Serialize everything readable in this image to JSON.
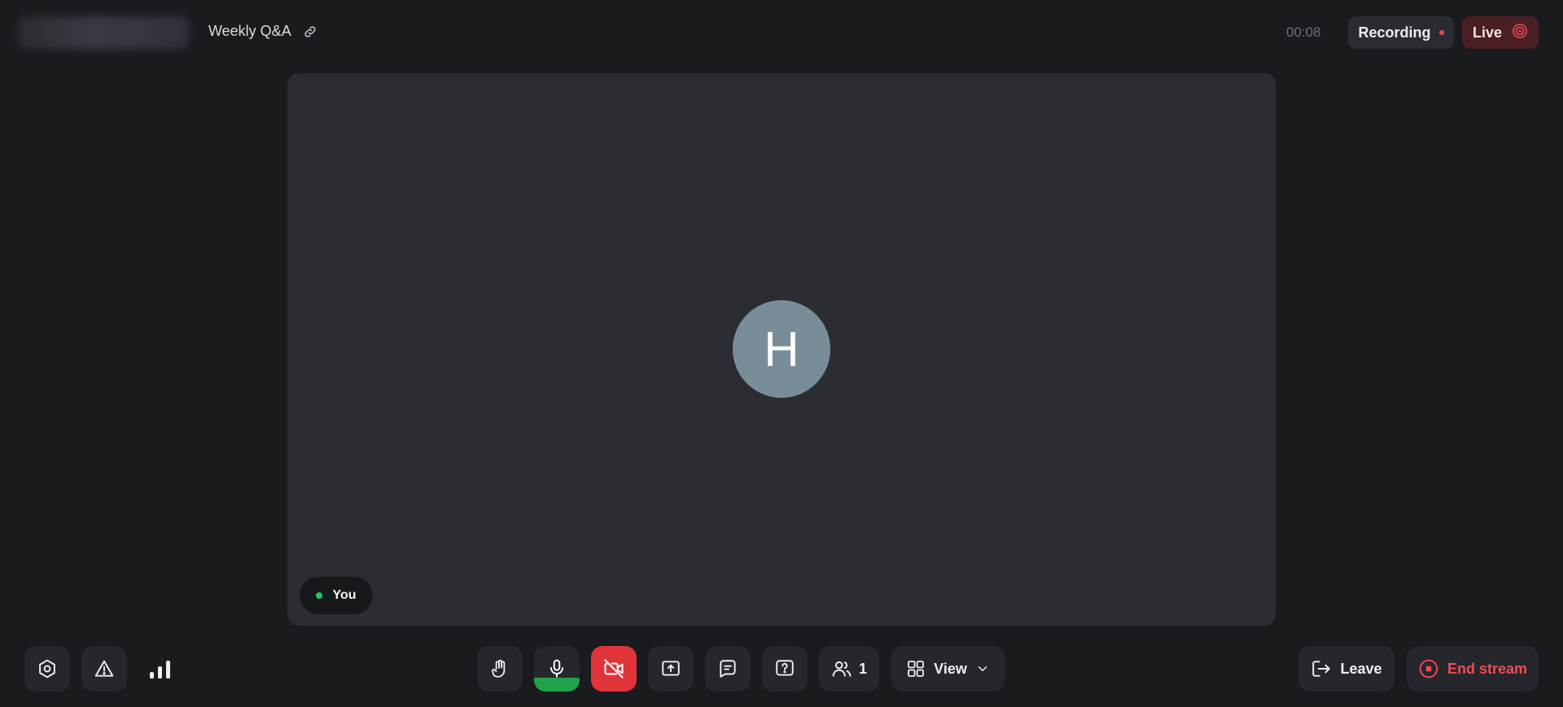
{
  "header": {
    "meeting_title": "Weekly Q&A",
    "timer": "00:08",
    "recording_label": "Recording",
    "live_label": "Live"
  },
  "stage": {
    "avatar_initial": "H",
    "participant_label": "You"
  },
  "toolbar": {
    "left": [
      {
        "name": "settings",
        "icon": "hexagon-settings-icon"
      },
      {
        "name": "report-issue",
        "icon": "warning-triangle-icon"
      },
      {
        "name": "connection-quality",
        "icon": "signal-bars-icon"
      }
    ],
    "center": [
      {
        "name": "raise-hand",
        "icon": "hand-icon"
      },
      {
        "name": "microphone",
        "icon": "microphone-icon",
        "active": true,
        "audio_level": 0.3
      },
      {
        "name": "camera",
        "icon": "camera-off-icon",
        "muted": true
      },
      {
        "name": "share-screen",
        "icon": "screen-share-icon"
      },
      {
        "name": "chat",
        "icon": "chat-icon"
      },
      {
        "name": "questions",
        "icon": "question-icon"
      },
      {
        "name": "participants",
        "icon": "people-icon"
      },
      {
        "name": "view",
        "icon": "grid-icon"
      }
    ],
    "participants_count": "1",
    "view_label": "View",
    "leave_label": "Leave",
    "end_stream_label": "End stream"
  },
  "colors": {
    "background": "#1a1b1f",
    "stage": "#2b2d32",
    "button": "#25272c",
    "avatar": "#798d99",
    "mic_active": "#1fa24a",
    "camera_off": "#e0333a",
    "danger_text": "#ef4b52",
    "live_bg": "#4a1f24",
    "online": "#22c55e"
  }
}
